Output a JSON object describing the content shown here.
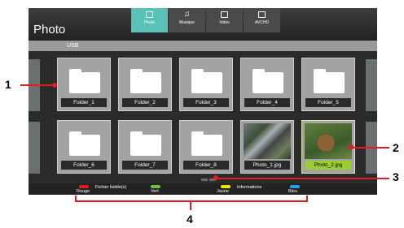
{
  "header": {
    "title": "Photo",
    "tabs": [
      {
        "label": "Photo",
        "icon": "photo-icon",
        "active": true
      },
      {
        "label": "Musique",
        "icon": "music-icon",
        "active": false
      },
      {
        "label": "Video",
        "icon": "video-icon",
        "active": false
      },
      {
        "label": "AVCHD",
        "icon": "avchd-icon",
        "active": false
      }
    ]
  },
  "source": {
    "label": "USB"
  },
  "items": [
    {
      "label": "Folder_1",
      "type": "folder"
    },
    {
      "label": "Folder_2",
      "type": "folder"
    },
    {
      "label": "Folder_3",
      "type": "folder"
    },
    {
      "label": "Folder_4",
      "type": "folder"
    },
    {
      "label": "Folder_5",
      "type": "folder"
    },
    {
      "label": "Folder_6",
      "type": "folder"
    },
    {
      "label": "Folder_7",
      "type": "folder"
    },
    {
      "label": "Folder_8",
      "type": "folder"
    },
    {
      "label": "Photo_1.jpg",
      "type": "photo"
    },
    {
      "label": "Photo_2.jpg",
      "type": "photo",
      "selected": true
    }
  ],
  "footer": {
    "red": "Rouge",
    "readable": "Fichier lisible(s)",
    "green": "Vert",
    "yellow": "Jaune",
    "info": "Informations",
    "blue": "Bleu"
  },
  "colors": {
    "accent": "#59c1b8",
    "selected": "#9acd32",
    "red": "#e11b22",
    "green": "#6dc04b",
    "yellow": "#f2e600",
    "blue": "#1fa3e0"
  },
  "callouts": [
    "1",
    "2",
    "3",
    "4"
  ]
}
